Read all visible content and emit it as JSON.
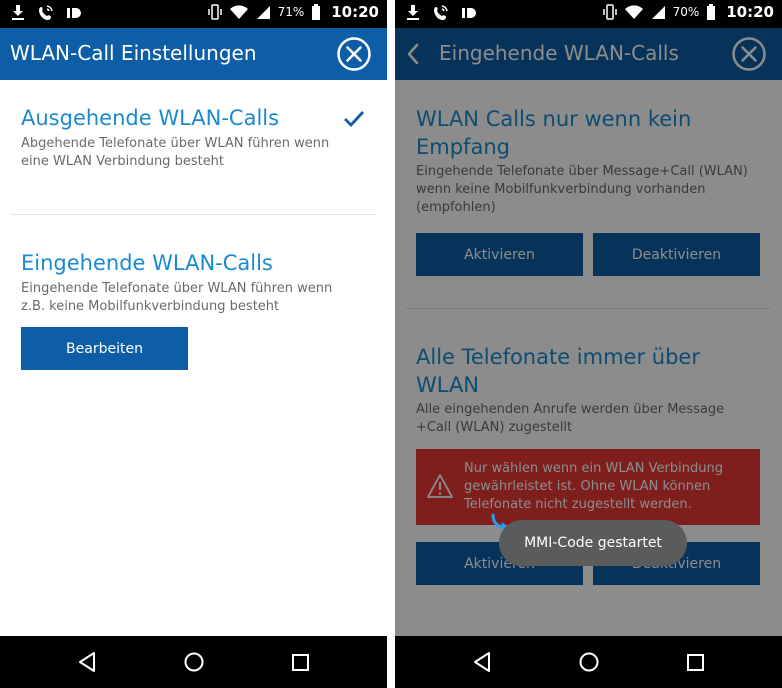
{
  "left": {
    "status": {
      "battery": "71%",
      "time": "10:20"
    },
    "appbar": {
      "title": "WLAN-Call Einstellungen"
    },
    "sections": [
      {
        "title": "Ausgehende WLAN-Calls",
        "desc": [
          "Abgehende Telefonate über WLAN führen wenn",
          "eine WLAN Verbindung besteht"
        ]
      },
      {
        "title": "Eingehende WLAN-Calls",
        "desc": [
          "Eingehende Telefonate über WLAN führen wenn",
          "z.B. keine Mobilfunkverbindung besteht"
        ],
        "button": "Bearbeiten"
      }
    ]
  },
  "right": {
    "status": {
      "battery": "70%",
      "time": "10:20"
    },
    "appbar": {
      "title": "Eingehende WLAN-Calls"
    },
    "sections": [
      {
        "title": [
          "WLAN Calls nur wenn kein",
          "Empfang"
        ],
        "desc": [
          "Eingehende Telefonate über Message+Call (WLAN)",
          "wenn keine Mobilfunkverbindung vorhanden",
          "(empfohlen)"
        ],
        "btn_activate": "Aktivieren",
        "btn_deactivate": "Deaktivieren"
      },
      {
        "title": [
          "Alle Telefonate immer über",
          "WLAN"
        ],
        "desc": [
          "Alle eingehenden Anrufe werden über Message",
          "+Call (WLAN) zugestellt"
        ],
        "btn_activate": "Aktivieren",
        "btn_deactivate": "Deaktivieren"
      }
    ],
    "warning": [
      "Nur wählen wenn ein WLAN Verbindung",
      "gewährleistet ist. Ohne WLAN können",
      "Telefonate nicht zugestellt werden."
    ],
    "toast": "MMI-Code gestartet"
  },
  "icons": {
    "status_left": [
      "download-icon",
      "wifi-call-icon",
      "id-icon"
    ],
    "status_right": [
      "vibrate-icon",
      "wifi-icon",
      "signal-icon",
      "battery-icon"
    ],
    "nav": [
      "back-icon",
      "home-icon",
      "recents-icon"
    ]
  },
  "colors": {
    "primary": "#0d5ea6",
    "title_blue": "#1a8ad0",
    "warning": "#e53935",
    "toast": "#5b5b5b"
  }
}
